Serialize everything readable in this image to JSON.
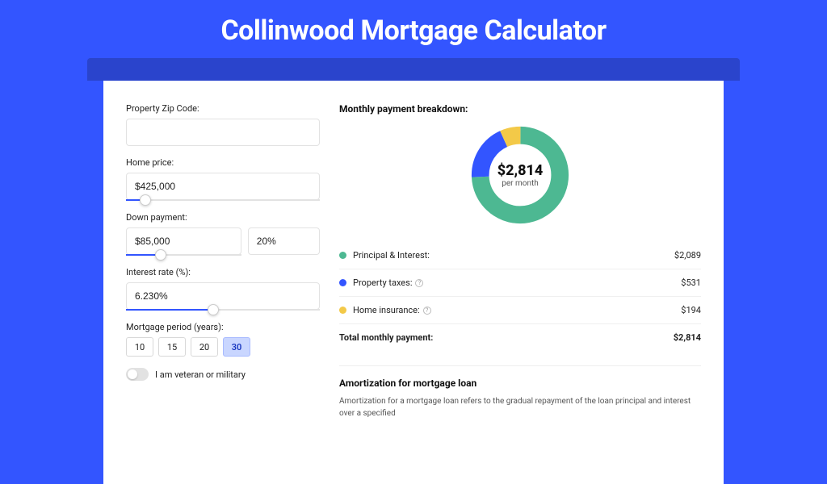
{
  "page": {
    "title": "Collinwood Mortgage Calculator"
  },
  "form": {
    "zip": {
      "label": "Property Zip Code:",
      "value": ""
    },
    "price": {
      "label": "Home price:",
      "value": "$425,000",
      "slider_pct": 10
    },
    "down": {
      "label": "Down payment:",
      "value": "$85,000",
      "pct_value": "20%",
      "slider_pct": 30
    },
    "rate": {
      "label": "Interest rate (%):",
      "value": "6.230%",
      "slider_pct": 45
    },
    "period": {
      "label": "Mortgage period (years):",
      "options": [
        "10",
        "15",
        "20",
        "30"
      ],
      "selected": "30"
    },
    "veteran": {
      "label": "I am veteran or military",
      "on": false
    }
  },
  "breakdown": {
    "title": "Monthly payment breakdown:",
    "center_amount": "$2,814",
    "center_sub": "per month",
    "rows": [
      {
        "color": "#4db892",
        "label": "Principal & Interest:",
        "info": false,
        "value": "$2,089"
      },
      {
        "color": "#3355ff",
        "label": "Property taxes:",
        "info": true,
        "value": "$531"
      },
      {
        "color": "#f3c948",
        "label": "Home insurance:",
        "info": true,
        "value": "$194"
      }
    ],
    "total": {
      "label": "Total monthly payment:",
      "value": "$2,814"
    }
  },
  "amort": {
    "title": "Amortization for mortgage loan",
    "text": "Amortization for a mortgage loan refers to the gradual repayment of the loan principal and interest over a specified"
  },
  "chart_data": {
    "type": "pie",
    "title": "Monthly payment breakdown",
    "series": [
      {
        "name": "Principal & Interest",
        "value": 2089,
        "color": "#4db892"
      },
      {
        "name": "Property taxes",
        "value": 531,
        "color": "#3355ff"
      },
      {
        "name": "Home insurance",
        "value": 194,
        "color": "#f3c948"
      }
    ],
    "total": 2814,
    "center_label": "$2,814 per month"
  }
}
